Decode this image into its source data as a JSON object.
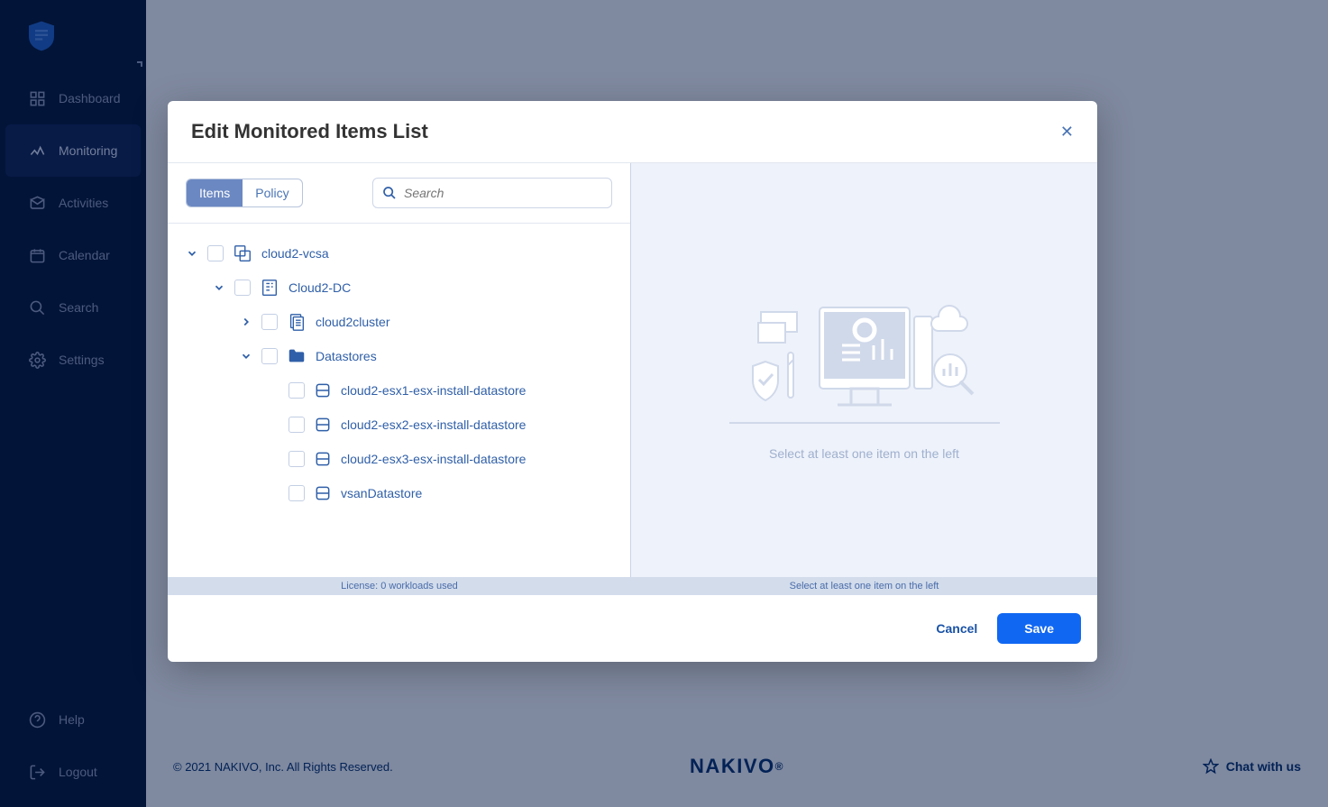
{
  "sidebar": {
    "items": [
      {
        "label": "Dashboard"
      },
      {
        "label": "Monitoring"
      },
      {
        "label": "Activities"
      },
      {
        "label": "Calendar"
      },
      {
        "label": "Search"
      },
      {
        "label": "Settings"
      }
    ],
    "bottom": [
      {
        "label": "Help"
      },
      {
        "label": "Logout"
      }
    ]
  },
  "modal": {
    "title": "Edit Monitored Items List",
    "tabs": {
      "items": "Items",
      "policy": "Policy"
    },
    "search_placeholder": "Search",
    "tree": {
      "root": "cloud2-vcsa",
      "dc": "Cloud2-DC",
      "cluster": "cloud2cluster",
      "ds_folder": "Datastores",
      "ds": [
        "cloud2-esx1-esx-install-datastore",
        "cloud2-esx2-esx-install-datastore",
        "cloud2-esx3-esx-install-datastore",
        "vsanDatastore"
      ]
    },
    "license": "License: 0 workloads used",
    "right_msg": "Select at least one item on the left",
    "bottom_right": "Select at least one item on the left",
    "cancel": "Cancel",
    "save": "Save"
  },
  "footer": {
    "copyright": "© 2021 NAKIVO, Inc. All Rights Reserved.",
    "brand": "NAKIVO",
    "chat": "Chat with us"
  }
}
